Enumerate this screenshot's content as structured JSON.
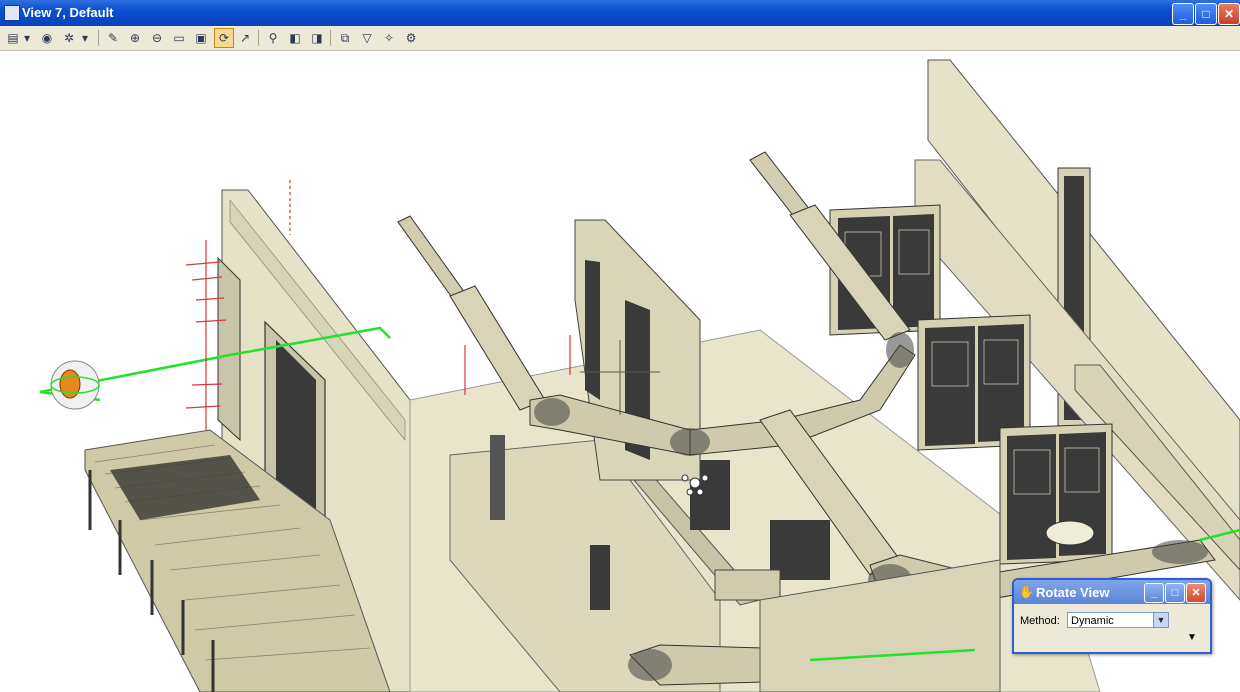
{
  "window": {
    "title": "View 7, Default",
    "controls": {
      "minimize": "_",
      "maximize": "□",
      "close": "✕"
    }
  },
  "toolbar": {
    "icons": [
      "view-display-icon",
      "view-attributes-icon",
      "display-style-icon",
      "update-view-icon",
      "zoom-in-icon",
      "zoom-out-icon",
      "window-area-icon",
      "fit-view-icon",
      "rotate-view-icon",
      "pan-view-icon",
      "walk-icon",
      "previous-view-icon",
      "next-view-icon",
      "view-groups-icon",
      "clip-volume-icon",
      "render-icon",
      "settings-icon"
    ],
    "active_icon": "rotate-view-icon"
  },
  "dialog": {
    "title": "Rotate View",
    "method_label": "Method:",
    "method_value": "Dynamic",
    "expand_glyph": "▼"
  },
  "colors": {
    "titlebar": "#0a4fd0",
    "model_wall": "#e6e2c8",
    "model_dark": "#3a3a3a",
    "guide_green": "#22e22a"
  }
}
